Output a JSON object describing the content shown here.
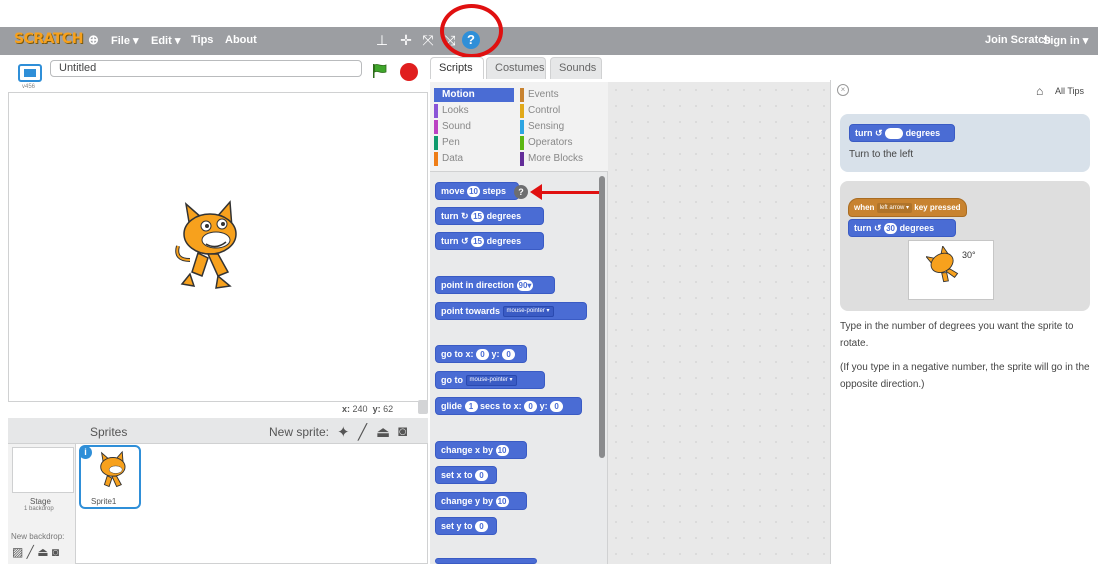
{
  "menubar": {
    "logo": "SCRATCH",
    "items": [
      "File ▾",
      "Edit ▾",
      "Tips",
      "About"
    ],
    "join": "Join Scratch",
    "signin": "Sign in ▾"
  },
  "stage": {
    "project_title": "Untitled",
    "version": "v456",
    "coords_x_label": "x:",
    "coords_x": "240",
    "coords_y_label": "y:",
    "coords_y": "62"
  },
  "sprites": {
    "label": "Sprites",
    "new_sprite": "New sprite:",
    "stage_name": "Stage",
    "stage_backdrops": "1 backdrop",
    "new_backdrop": "New backdrop:",
    "sprite1": "Sprite1"
  },
  "tabs": [
    "Scripts",
    "Costumes",
    "Sounds"
  ],
  "categories": {
    "left": [
      "Motion",
      "Looks",
      "Sound",
      "Pen",
      "Data"
    ],
    "right": [
      "Events",
      "Control",
      "Sensing",
      "Operators",
      "More Blocks"
    ],
    "colors_left": [
      "#4a6cd4",
      "#8a55d7",
      "#bb42c3",
      "#0e9a6c",
      "#ee7d16"
    ],
    "colors_right": [
      "#c88330",
      "#e1a91a",
      "#2ca5e2",
      "#5cb712",
      "#632d99"
    ]
  },
  "blocks": {
    "move": "move",
    "move_num": "10",
    "move_unit": "steps",
    "turn": "turn",
    "turn_num": "15",
    "degrees": "degrees",
    "point_dir": "point in direction",
    "point_dir_val": "90▾",
    "point_towards": "point towards",
    "mouse_pointer": "mouse-pointer ▾",
    "goto_xy": "go to x:",
    "y_label": "y:",
    "zero": "0",
    "goto": "go to",
    "glide": "glide",
    "glide_num": "1",
    "glide_mid": "secs to x:",
    "change_x": "change x by",
    "ten": "10",
    "set_x": "set x to",
    "change_y": "change y by",
    "set_y": "set y to"
  },
  "tips": {
    "all_tips": "All Tips",
    "card1_block": "turn",
    "card1_text": "Turn to the left",
    "hat_when": "when",
    "hat_key": "left arrow ▾",
    "hat_pressed": "key pressed",
    "demo_turn_num": "30",
    "demo_angle": "30°",
    "para1": "Type in the number of degrees you want the sprite to rotate.",
    "para2": "(If you type in a negative number, the sprite will go in the opposite direction.)"
  }
}
